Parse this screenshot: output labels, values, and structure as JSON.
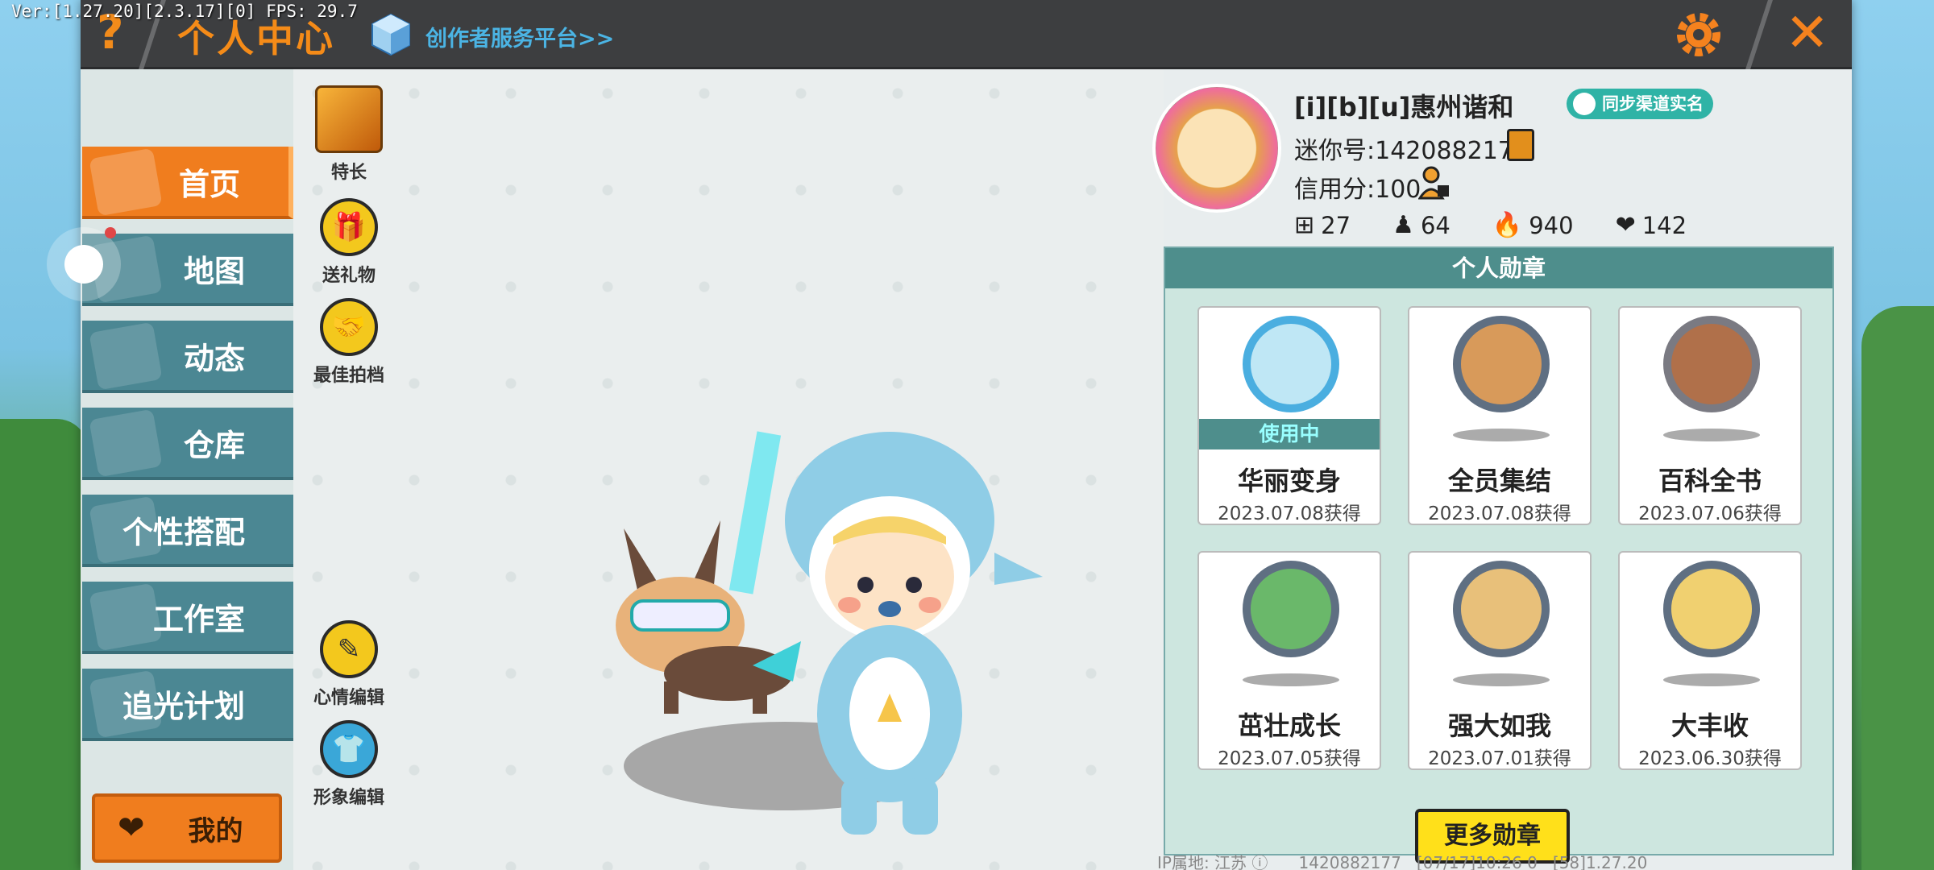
{
  "debug": {
    "fps_text": "Ver:[1.27.20][2.3.17][0] FPS: 29.7"
  },
  "header": {
    "help_label": "?",
    "title": "个人中心",
    "creator_link": "创作者服务平台>>",
    "close_label": "✕"
  },
  "sidebar": {
    "items": [
      {
        "label": "首页",
        "active": true
      },
      {
        "label": "地图"
      },
      {
        "label": "动态"
      },
      {
        "label": "仓库"
      },
      {
        "label": "个性搭配"
      },
      {
        "label": "工作室"
      },
      {
        "label": "追光计划"
      }
    ],
    "mine_label": "我的"
  },
  "actions": {
    "specialty": "特长",
    "gift": "送礼物",
    "partner": "最佳拍档",
    "mood_edit": "心情编辑",
    "image_edit": "形象编辑"
  },
  "profile": {
    "username": "[i][b][u]惠州谐和",
    "realname_badge": "同步渠道实名",
    "mini_id": "迷你号:1420882177",
    "credit": "信用分:100",
    "stats": {
      "plus": "27",
      "fans": "64",
      "heat": "940",
      "likes": "142"
    }
  },
  "medals": {
    "header": "个人勋章",
    "in_use_label": "使用中",
    "items": [
      {
        "name": "华丽变身",
        "date": "2023.07.08获得",
        "in_use": true,
        "color": "#4aaee0"
      },
      {
        "name": "全员集结",
        "date": "2023.07.08获得",
        "color": "#5f6f82"
      },
      {
        "name": "百科全书",
        "date": "2023.07.06获得",
        "color": "#7a7a82"
      },
      {
        "name": "茁壮成长",
        "date": "2023.07.05获得",
        "color": "#5f6f82"
      },
      {
        "name": "强大如我",
        "date": "2023.07.01获得",
        "color": "#5f6f82"
      },
      {
        "name": "大丰收",
        "date": "2023.06.30获得",
        "color": "#5f6f82"
      }
    ],
    "more_label": "更多勋章"
  },
  "footer": {
    "text": "IP属地: 江苏 ⓘ      1420882177   [07/17]10:26 0   [58]1.27.20"
  },
  "colors": {
    "accent": "#f07d1e",
    "teal": "#4e8e8c",
    "sidebar": "#4b8793"
  }
}
